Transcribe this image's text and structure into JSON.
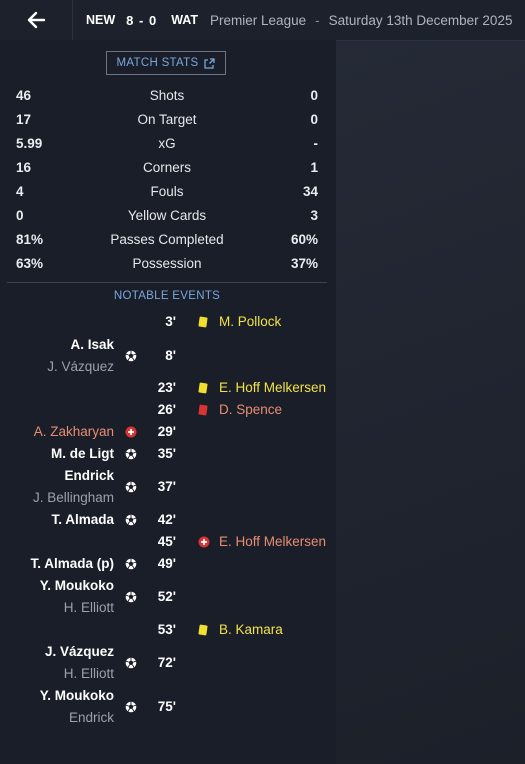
{
  "header": {
    "home_team": "NEW",
    "score": "8 - 0",
    "away_team": "WAT",
    "competition": "Premier League",
    "separator": "-",
    "date": "Saturday 13th December 2025"
  },
  "match_stats_button": "MATCH STATS",
  "stats": [
    {
      "home": "46",
      "label": "Shots",
      "away": "0"
    },
    {
      "home": "17",
      "label": "On Target",
      "away": "0"
    },
    {
      "home": "5.99",
      "label": "xG",
      "away": "-"
    },
    {
      "home": "16",
      "label": "Corners",
      "away": "1"
    },
    {
      "home": "4",
      "label": "Fouls",
      "away": "34"
    },
    {
      "home": "0",
      "label": "Yellow Cards",
      "away": "3"
    },
    {
      "home": "81%",
      "label": "Passes Completed",
      "away": "60%"
    },
    {
      "home": "63%",
      "label": "Possession",
      "away": "37%"
    }
  ],
  "events_title": "NOTABLE EVENTS",
  "events": [
    {
      "minute": "3'",
      "away_player": "M. Pollock",
      "type": "yellow-card"
    },
    {
      "minute": "8'",
      "home_player": "A. Isak",
      "home_assist": "J. Vázquez",
      "type": "goal"
    },
    {
      "minute": "23'",
      "away_player": "E. Hoff Melkersen",
      "type": "yellow-card"
    },
    {
      "minute": "26'",
      "away_player": "D. Spence",
      "type": "red-card"
    },
    {
      "minute": "29'",
      "home_player": "A. Zakharyan",
      "type": "injury"
    },
    {
      "minute": "35'",
      "home_player": "M. de Ligt",
      "type": "goal"
    },
    {
      "minute": "37'",
      "home_player": "Endrick",
      "home_assist": "J. Bellingham",
      "type": "goal"
    },
    {
      "minute": "42'",
      "home_player": "T. Almada",
      "type": "goal"
    },
    {
      "minute": "45'",
      "away_player": "E. Hoff Melkersen",
      "type": "injury"
    },
    {
      "minute": "49'",
      "home_player": "T. Almada (p)",
      "type": "goal"
    },
    {
      "minute": "52'",
      "home_player": "Y. Moukoko",
      "home_assist": "H. Elliott",
      "type": "goal"
    },
    {
      "minute": "53'",
      "away_player": "B. Kamara",
      "type": "yellow-card"
    },
    {
      "minute": "72'",
      "home_player": "J. Vázquez",
      "home_assist": "H. Elliott",
      "type": "goal"
    },
    {
      "minute": "75'",
      "home_player": "Y. Moukoko",
      "home_assist": "Endrick",
      "type": "goal"
    }
  ],
  "colors": {
    "yellow_card": "#f0df2c",
    "red_card": "#d93434",
    "injury": "#e98d72",
    "accent_blue": "#7aa7dc"
  }
}
